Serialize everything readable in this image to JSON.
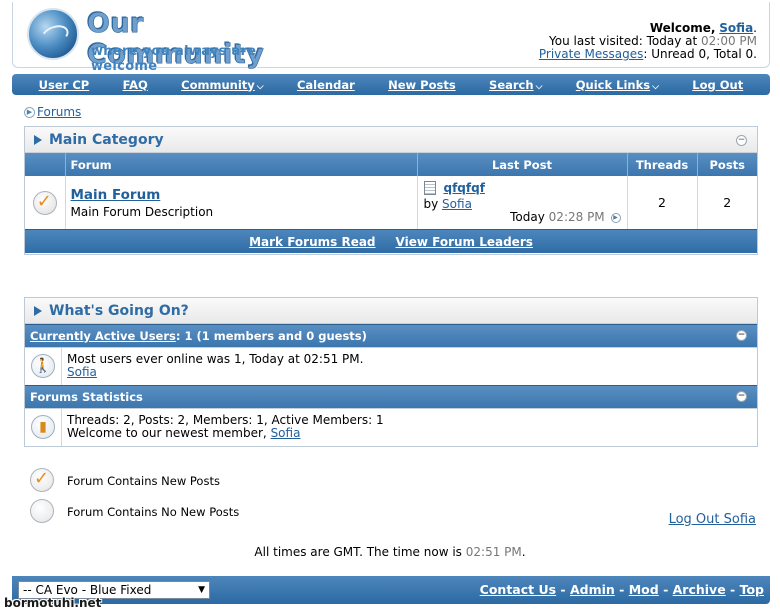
{
  "header": {
    "logo_title": "Our Community",
    "logo_subtitle": "where you always are welcome",
    "welcome_prefix": "Welcome,",
    "username": "Sofia",
    "welcome_suffix": ".",
    "last_visited_label": "You last visited: Today at",
    "last_visited_time": "02:00 PM",
    "pm_link": "Private Messages",
    "pm_status": ": Unread 0, Total 0."
  },
  "navbar": {
    "items": [
      {
        "label": "User CP",
        "dropdown": false
      },
      {
        "label": "FAQ",
        "dropdown": false
      },
      {
        "label": "Community",
        "dropdown": true
      },
      {
        "label": "Calendar",
        "dropdown": false
      },
      {
        "label": "New Posts",
        "dropdown": false
      },
      {
        "label": "Search",
        "dropdown": true
      },
      {
        "label": "Quick Links",
        "dropdown": true
      },
      {
        "label": "Log Out",
        "dropdown": false
      }
    ],
    "chevron": "⌵"
  },
  "breadcrumb": {
    "label": "Forums"
  },
  "main_category": {
    "title": "Main Category",
    "collapse": "−",
    "columns": {
      "forum": "Forum",
      "last_post": "Last Post",
      "threads": "Threads",
      "posts": "Posts"
    },
    "forums": [
      {
        "name": "Main Forum",
        "description": "Main Forum Description",
        "last_post_title": "qfqfqf",
        "last_post_by_label": "by",
        "last_post_by": "Sofia",
        "last_post_day": "Today",
        "last_post_time": "02:28 PM",
        "threads": "2",
        "posts": "2"
      }
    ],
    "footer_links": [
      "Mark Forums Read",
      "View Forum Leaders"
    ]
  },
  "whats_going_on": {
    "title": "What's Going On?",
    "active_users_link": "Currently Active Users",
    "active_users_count": ": 1 (1 members and 0 guests)",
    "most_online": "Most users ever online was 1, Today at 02:51 PM.",
    "online_user": "Sofia",
    "stats_title": "Forums Statistics",
    "stats_line": "Threads: 2, Posts: 2, Members: 1, Active Members: 1",
    "newest_label": "Welcome to our newest member,",
    "newest_member": "Sofia"
  },
  "legend": {
    "new_posts": "Forum Contains New Posts",
    "no_new_posts": "Forum Contains No New Posts"
  },
  "logout_link": "Log Out Sofia",
  "times": {
    "prefix": "All times are GMT. The time now is",
    "time": "02:51 PM",
    "suffix": "."
  },
  "footer": {
    "style_select": "-- CA Evo - Blue Fixed",
    "links": [
      "Contact Us",
      "Admin",
      "Mod",
      "Archive",
      "Top"
    ],
    "separator": " - "
  },
  "watermark": "bormotuhi.net",
  "colors": {
    "accent": "#2f6ca6",
    "link": "#22609c",
    "new_post_check": "#f08a14"
  }
}
